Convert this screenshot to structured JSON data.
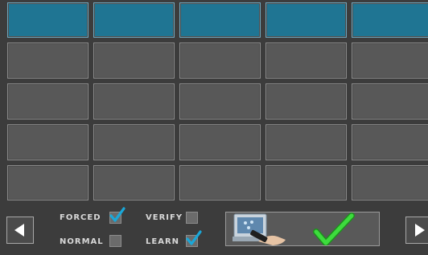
{
  "grid": {
    "columns": 5,
    "rows": 5,
    "active_row": 0
  },
  "options": {
    "forced": {
      "label": "FORCED",
      "checked": true
    },
    "verify": {
      "label": "VERIFY",
      "checked": false
    },
    "normal": {
      "label": "NORMAL",
      "checked": false
    },
    "learn": {
      "label": "LEARN",
      "checked": true
    }
  },
  "icons": {
    "prev": "left-arrow-icon",
    "next": "right-arrow-icon",
    "apply": "remote-control-icon",
    "confirm": "green-checkmark-icon",
    "check": "cyan-check-icon"
  },
  "colors": {
    "background": "#3c3c3c",
    "cell": "#585858",
    "active_cell": "#1f7593",
    "check_cyan": "#1aa7d8",
    "confirm_green": "#2fc62f"
  }
}
